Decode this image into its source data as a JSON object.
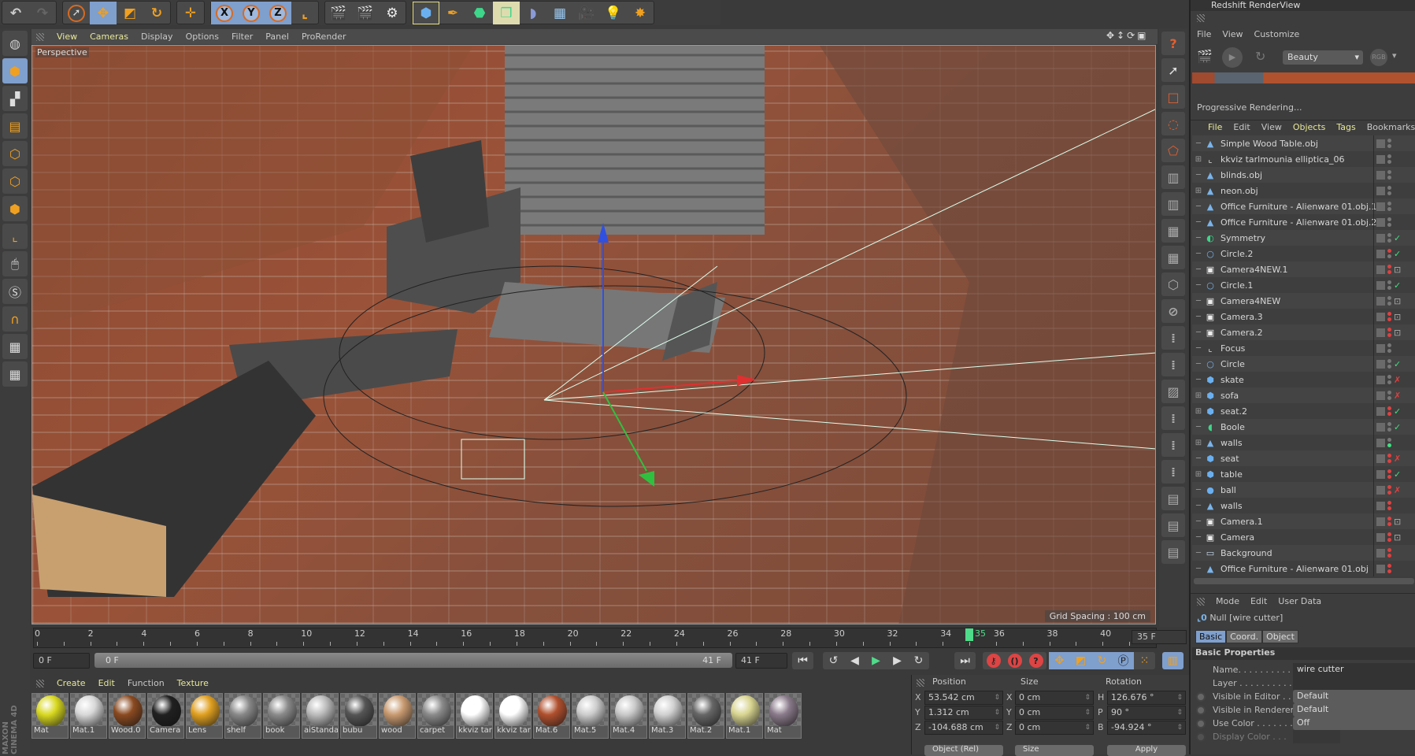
{
  "toolbar": {
    "icons": [
      "undo-icon",
      "redo-icon",
      "select-icon",
      "move-icon",
      "scale-icon",
      "rotate-icon",
      "transform-icon",
      "x-axis-lock-icon",
      "y-axis-lock-icon",
      "z-axis-lock-icon",
      "coordinate-system-icon",
      "render-view-icon",
      "render-picture-viewer-icon",
      "render-settings-icon",
      "cube-icon",
      "pen-icon",
      "subdivision-icon",
      "array-icon",
      "deformer-icon",
      "floor-icon",
      "camera-icon",
      "light-icon",
      "xyz-icon"
    ],
    "x": "X",
    "y": "Y",
    "z": "Z"
  },
  "viewport": {
    "menu": [
      "View",
      "Cameras",
      "Display",
      "Options",
      "Filter",
      "Panel",
      "ProRender"
    ],
    "label": "Perspective",
    "grid_spacing": "Grid Spacing : 100 cm"
  },
  "timeline": {
    "ticks": [
      "0",
      "2",
      "4",
      "6",
      "8",
      "10",
      "12",
      "14",
      "16",
      "18",
      "20",
      "22",
      "24",
      "26",
      "28",
      "30",
      "32",
      "34",
      "36",
      "38",
      "40"
    ],
    "current_frame": "35",
    "current_frame_value": 35,
    "max_frame": 41,
    "frame_field": "35 F",
    "start_field": "0 F",
    "range_start": "0 F",
    "range_end": "41 F",
    "end_field": "41 F"
  },
  "materials": {
    "menu": [
      "Create",
      "Edit",
      "Function",
      "Texture"
    ],
    "items": [
      {
        "name": "Mat",
        "color": "#d8d820"
      },
      {
        "name": "Mat.1",
        "color": "#d8d8d8"
      },
      {
        "name": "Wood.0",
        "color": "#8a4a20"
      },
      {
        "name": "Camera",
        "color": "#202020"
      },
      {
        "name": "Lens",
        "color": "#e0a020"
      },
      {
        "name": "shelf",
        "color": "#888888"
      },
      {
        "name": "book",
        "color": "#8a8a8a"
      },
      {
        "name": "aiStanda",
        "color": "#bbbbbb"
      },
      {
        "name": "bubu",
        "color": "#555555"
      },
      {
        "name": "wood",
        "color": "#c89a70"
      },
      {
        "name": "carpet",
        "color": "#8a8a8a"
      },
      {
        "name": "kkviz tar",
        "color": "#ffffff"
      },
      {
        "name": "kkviz tar",
        "color": "#ffffff"
      },
      {
        "name": "Mat.6",
        "color": "#b0502e"
      },
      {
        "name": "Mat.5",
        "color": "#cccccc"
      },
      {
        "name": "Mat.4",
        "color": "#c8c8c8"
      },
      {
        "name": "Mat.3",
        "color": "#d0d0d0"
      },
      {
        "name": "Mat.2",
        "color": "#666666"
      },
      {
        "name": "Mat.1",
        "color": "#d8d490"
      },
      {
        "name": "Mat",
        "color": "#8a7a8a"
      }
    ],
    "brand": "MAXON CINEMA 4D"
  },
  "coordinates": {
    "headers": {
      "position": "Position",
      "size": "Size",
      "rotation": "Rotation"
    },
    "rows": [
      {
        "axis": "X",
        "pos": "53.542 cm",
        "size_axis": "X",
        "size": "0 cm",
        "rot_axis": "H",
        "rot": "126.676 °"
      },
      {
        "axis": "Y",
        "pos": "1.312 cm",
        "size_axis": "Y",
        "size": "0 cm",
        "rot_axis": "P",
        "rot": "90 °"
      },
      {
        "axis": "Z",
        "pos": "-104.688 cm",
        "size_axis": "Z",
        "size": "0 cm",
        "rot_axis": "B",
        "rot": "-94.924 °"
      }
    ],
    "mode": "Object (Rel)",
    "size_mode": "Size",
    "apply": "Apply"
  },
  "redshift": {
    "title": "Redshift RenderView",
    "menu": [
      "File",
      "View",
      "Customize"
    ],
    "aov": "Beauty",
    "rgb": "RGB",
    "status": "Progressive Rendering..."
  },
  "objects": {
    "menu": [
      "File",
      "Edit",
      "View",
      "Objects",
      "Tags",
      "Bookmarks"
    ],
    "items": [
      {
        "name": "Simple Wood Table.obj",
        "icon": "polygon-object-icon",
        "expand": false,
        "dots": "gg",
        "check": ""
      },
      {
        "name": "kkviz tarlmounia elliptica_06",
        "icon": "null-icon",
        "expand": true,
        "dots": "gg",
        "check": ""
      },
      {
        "name": "blinds.obj",
        "icon": "polygon-object-icon",
        "expand": false,
        "dots": "gg",
        "check": ""
      },
      {
        "name": "neon.obj",
        "icon": "polygon-object-icon",
        "expand": true,
        "dots": "gg",
        "check": ""
      },
      {
        "name": "Office Furniture - Alienware 01.obj.1",
        "icon": "polygon-object-icon",
        "expand": false,
        "dots": "gg",
        "check": ""
      },
      {
        "name": "Office Furniture - Alienware 01.obj.2",
        "icon": "polygon-object-icon",
        "expand": false,
        "dots": "gg",
        "check": ""
      },
      {
        "name": "Symmetry",
        "icon": "symmetry-icon",
        "expand": false,
        "dots": "gg",
        "check": "✓"
      },
      {
        "name": "Circle.2",
        "icon": "circle-spline-icon",
        "expand": false,
        "dots": "rg",
        "check": "✓"
      },
      {
        "name": "Camera4NEW.1",
        "icon": "camera-icon",
        "expand": false,
        "dots": "rr",
        "check": "⊡"
      },
      {
        "name": "Circle.1",
        "icon": "circle-spline-icon",
        "expand": false,
        "dots": "gg",
        "check": "✓"
      },
      {
        "name": "Camera4NEW",
        "icon": "camera-icon",
        "expand": false,
        "dots": "gg",
        "check": "⊡"
      },
      {
        "name": "Camera.3",
        "icon": "camera-icon",
        "expand": false,
        "dots": "rr",
        "check": "⊡"
      },
      {
        "name": "Camera.2",
        "icon": "camera-icon",
        "expand": false,
        "dots": "rr",
        "check": "⊡"
      },
      {
        "name": "Focus",
        "icon": "null-icon",
        "expand": false,
        "dots": "gg",
        "check": ""
      },
      {
        "name": "Circle",
        "icon": "circle-spline-icon",
        "expand": false,
        "dots": "gg",
        "check": "✓"
      },
      {
        "name": "skate",
        "icon": "cube-icon",
        "expand": false,
        "dots": "gg",
        "check": "✗"
      },
      {
        "name": "sofa",
        "icon": "cube-icon",
        "expand": true,
        "dots": "gg",
        "check": "✗"
      },
      {
        "name": "seat.2",
        "icon": "cube-icon",
        "expand": true,
        "dots": "rr",
        "check": "✓"
      },
      {
        "name": "Boole",
        "icon": "boole-icon",
        "expand": false,
        "dots": "gg",
        "check": "✓"
      },
      {
        "name": "walls",
        "icon": "polygon-object-icon",
        "expand": true,
        "dots": "gG",
        "check": ""
      },
      {
        "name": "seat",
        "icon": "cube-icon",
        "expand": false,
        "dots": "rr",
        "check": "✗"
      },
      {
        "name": "table",
        "icon": "cube-icon",
        "expand": true,
        "dots": "rr",
        "check": "✓"
      },
      {
        "name": "ball",
        "icon": "sphere-icon",
        "expand": false,
        "dots": "rr",
        "check": "✗"
      },
      {
        "name": "walls",
        "icon": "polygon-object-icon",
        "expand": false,
        "dots": "rr",
        "check": ""
      },
      {
        "name": "Camera.1",
        "icon": "camera-icon",
        "expand": false,
        "dots": "rr",
        "check": "⊡"
      },
      {
        "name": "Camera",
        "icon": "camera-icon",
        "expand": false,
        "dots": "rr",
        "check": "⊡"
      },
      {
        "name": "Background",
        "icon": "background-icon",
        "expand": false,
        "dots": "rr",
        "check": ""
      },
      {
        "name": "Office Furniture - Alienware 01.obj",
        "icon": "polygon-object-icon",
        "expand": false,
        "dots": "rr",
        "check": ""
      }
    ]
  },
  "attributes": {
    "menu": [
      "Mode",
      "Edit",
      "User Data"
    ],
    "object_title": "Null [wire cutter]",
    "tabs": [
      "Basic",
      "Coord.",
      "Object"
    ],
    "active_tab": "Basic",
    "section": "Basic Properties",
    "props": [
      {
        "label": "Name. . . . . . . . . . . .",
        "value": "wire cutter",
        "radio": false
      },
      {
        "label": "Layer . . . . . . . . . . .",
        "value": "",
        "radio": false
      },
      {
        "label": "Visible in Editor . . .",
        "value": "Default",
        "radio": true
      },
      {
        "label": "Visible in Renderer",
        "value": "Default",
        "radio": true
      },
      {
        "label": "Use Color . . . . . . . .",
        "value": "Off",
        "radio": true
      },
      {
        "label": "Display Color . . .",
        "value": "",
        "radio": true
      }
    ]
  }
}
